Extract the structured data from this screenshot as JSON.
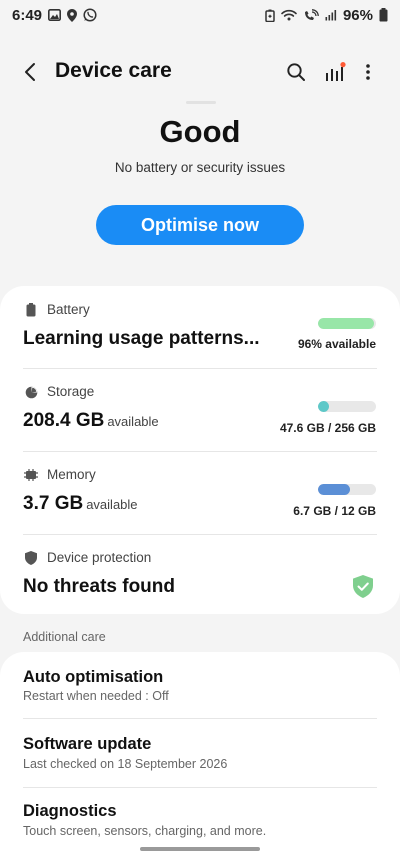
{
  "status_bar": {
    "time": "6:49",
    "battery": "96%",
    "left_icons": [
      "gallery-icon",
      "location-icon",
      "whatsapp-icon"
    ],
    "right_icons": [
      "battery-saver-icon",
      "wifi-icon",
      "wifi-calling-icon",
      "signal-icon",
      "battery-icon"
    ]
  },
  "app_bar": {
    "title": "Device care",
    "icons": [
      "back-icon",
      "search-icon",
      "chart-icon",
      "more-icon"
    ]
  },
  "summary": {
    "status": "Good",
    "subtitle": "No battery or security issues",
    "optimise_label": "Optimise now"
  },
  "battery": {
    "label": "Battery",
    "value": "Learning usage patterns...",
    "meta": "96% available",
    "level": 0.96,
    "color": "#98e6a8"
  },
  "storage": {
    "label": "Storage",
    "value": "208.4 GB",
    "unit": "available",
    "meta": "47.6 GB / 256 GB",
    "level": 0.186,
    "color": "#5ec8c8"
  },
  "memory": {
    "label": "Memory",
    "value": "3.7 GB",
    "unit": "available",
    "meta": "6.7 GB / 12 GB",
    "level": 0.558,
    "color": "#5b8fd6"
  },
  "protection": {
    "label": "Device protection",
    "value": "No threats found",
    "shield_color": "#7fcf8e"
  },
  "additional": {
    "header": "Additional care",
    "items": [
      {
        "title": "Auto optimisation",
        "subtitle": "Restart when needed : Off"
      },
      {
        "title": "Software update",
        "subtitle": "Last checked on 18 September 2026"
      },
      {
        "title": "Diagnostics",
        "subtitle": "Touch screen, sensors, charging, and more."
      }
    ]
  }
}
